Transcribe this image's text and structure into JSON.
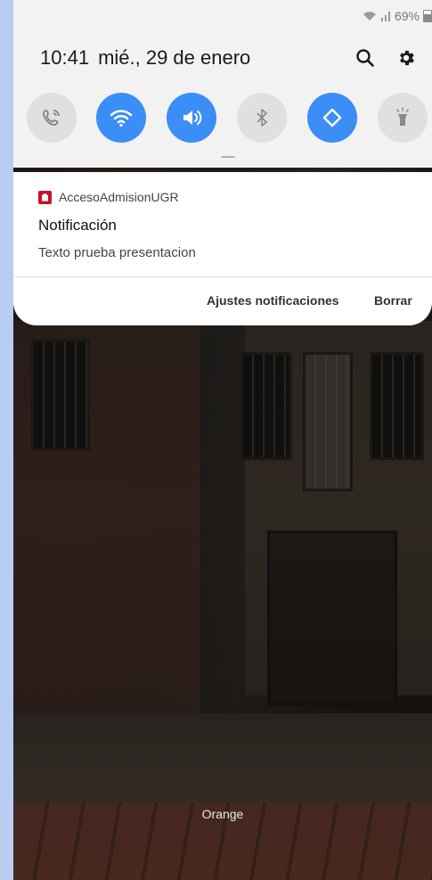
{
  "status": {
    "battery": "69%"
  },
  "header": {
    "time": "10:41",
    "date": "mié., 29 de enero"
  },
  "notification": {
    "app_name": "AccesoAdmisionUGR",
    "title": "Notificación",
    "text": "Texto prueba presentacion",
    "actions": [
      "Ajustes notificaciones",
      "Borrar"
    ]
  },
  "carrier": "Orange",
  "icons": {
    "header": [
      "search-icon",
      "gear-icon"
    ],
    "quick_settings": [
      "wifi-calling-icon",
      "wifi-icon",
      "sound-icon",
      "bluetooth-icon",
      "auto-rotate-icon",
      "flashlight-icon"
    ]
  },
  "colors": {
    "accent": "#3a8ef6",
    "brand": "#c8102e"
  }
}
